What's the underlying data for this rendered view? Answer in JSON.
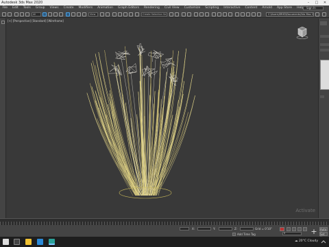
{
  "window": {
    "title": "Autodesk 3ds Max 2020",
    "controls": [
      "–",
      "□",
      "✕"
    ]
  },
  "menu": {
    "items": [
      "File",
      "Edit",
      "Tools",
      "Group",
      "Views",
      "Create",
      "Modifiers",
      "Animation",
      "Graph Editors",
      "Rendering",
      "Civil View",
      "Customize",
      "Scripting",
      "Interactive",
      "Content",
      "Arnold",
      "App Store",
      "Help"
    ],
    "sign_in": "Sign In"
  },
  "toolbar": {
    "selection_filter": "All",
    "view_dropdown": "View",
    "selection_set": "Create Selection Se",
    "project_path": "C:\\Users\\SRHD\\Documents\\3ds Max 2020"
  },
  "viewport": {
    "label": "[+] [Perspective] [Standard] [Wireframe]",
    "watermark": "Activate"
  },
  "status": {
    "x_field": "X:",
    "y_field": "Y:",
    "z_field": "Z:",
    "grid_value": "Grid = 0'10\"",
    "add_time_tag": "Add Time Tag",
    "auto_key": "Auto Key",
    "set_key": "Set Key",
    "frame": "0"
  },
  "taskbar": {
    "weather_temp": "20°C",
    "weather_text": "Cloudy"
  },
  "icons": {
    "viewcube": "house-cube-icon",
    "plant_colors": {
      "blade": "#e6d98a",
      "flower": "#f2efe4",
      "base": "#c8b85a"
    }
  }
}
